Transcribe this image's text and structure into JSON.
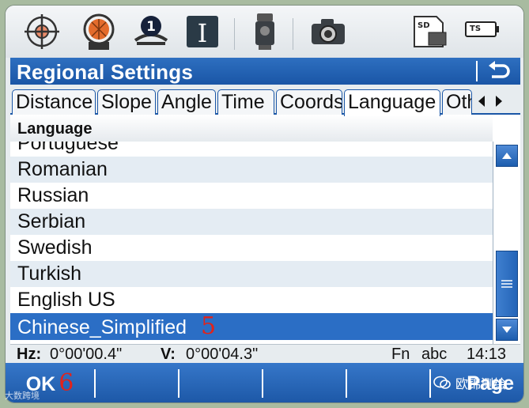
{
  "toolbar": {
    "icons": [
      "target-icon",
      "prism-icon",
      "face-indicator-icon",
      "input-cursor-icon",
      "total-station-icon",
      "camera-icon",
      "sd-card-icon",
      "battery-icon"
    ],
    "face_number": "1",
    "sd_label": "SD",
    "battery_label": "TS"
  },
  "title": "Regional Settings",
  "tabs": [
    {
      "label": "Distance",
      "active": false
    },
    {
      "label": "Slope",
      "active": false
    },
    {
      "label": "Angle",
      "active": false
    },
    {
      "label": "Time",
      "active": false
    },
    {
      "label": "Coords",
      "active": false
    },
    {
      "label": "Language",
      "active": true
    },
    {
      "label": "Oth",
      "active": false
    }
  ],
  "list": {
    "header": "Language",
    "rows": [
      {
        "label": "Portuguese"
      },
      {
        "label": "Romanian"
      },
      {
        "label": "Russian"
      },
      {
        "label": "Serbian"
      },
      {
        "label": "Swedish"
      },
      {
        "label": "Turkish"
      },
      {
        "label": "English US"
      },
      {
        "label": "Chinese_Simplified",
        "selected": true
      }
    ],
    "selected_marker": "5"
  },
  "status": {
    "hz_label": "Hz:",
    "hz_value": "0°00'00.4\"",
    "v_label": "V:",
    "v_value": "0°00'04.3\"",
    "fn": "Fn",
    "input_mode": "abc",
    "time": "14:13"
  },
  "softkeys": {
    "ok": "OK",
    "ok_marker": "6",
    "page": "Page"
  },
  "watermarks": {
    "left": "大数跨境",
    "right": "欧锦测绘"
  },
  "colors": {
    "accent": "#1a56a6",
    "selected_row": "#2b6ec5",
    "alt_row": "#e4ecf3",
    "marker_red": "#e2231a"
  }
}
